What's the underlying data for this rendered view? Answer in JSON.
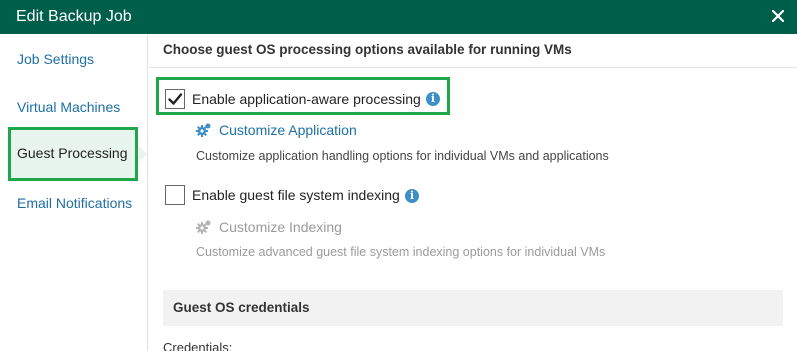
{
  "window": {
    "title": "Edit Backup Job",
    "close_icon": "close-icon"
  },
  "sidebar": {
    "items": [
      {
        "label": "Job Settings",
        "active": false
      },
      {
        "label": "Virtual Machines",
        "active": false
      },
      {
        "label": "Guest Processing",
        "active": true
      },
      {
        "label": "Email Notifications",
        "active": false
      }
    ]
  },
  "main": {
    "section_title": "Choose guest OS processing options available for running VMs",
    "app_aware": {
      "label": "Enable application-aware processing",
      "checked": true,
      "info_icon": "info-icon",
      "link_label": "Customize Application",
      "link_icon": "gear-icon",
      "description": "Customize application handling options for individual VMs and applications"
    },
    "indexing": {
      "label": "Enable guest file system indexing",
      "checked": false,
      "info_icon": "info-icon",
      "link_label": "Customize Indexing",
      "link_icon": "gear-icon",
      "description": "Customize advanced guest file system indexing options for individual VMs"
    },
    "credentials": {
      "section_title": "Guest OS credentials",
      "label": "Credentials:"
    }
  },
  "colors": {
    "titlebar": "#005f4b",
    "highlight": "#1fa84b",
    "link": "#1d6fa5",
    "info": "#3d8fc6",
    "disabled": "#9b9b9b"
  }
}
